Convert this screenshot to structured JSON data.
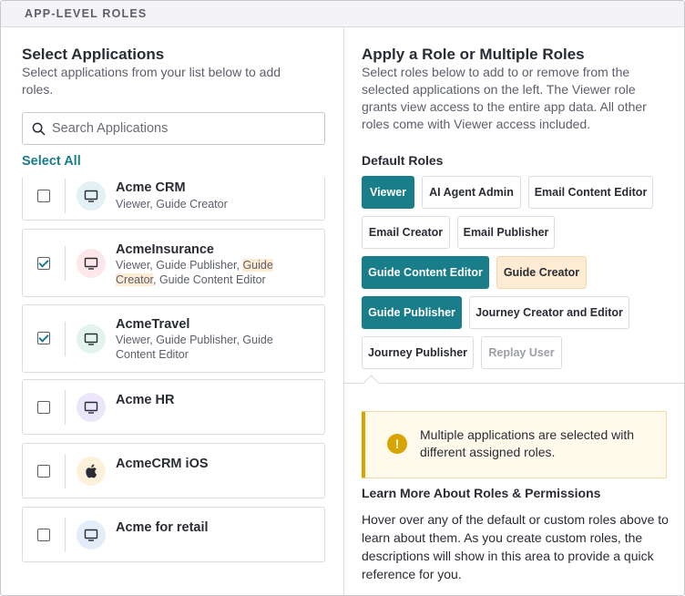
{
  "section": {
    "title": "APP-LEVEL ROLES"
  },
  "left": {
    "title": "Select Applications",
    "description": "Select applications from your list below to add roles.",
    "search_placeholder": "Search Applications",
    "select_all": "Select All",
    "apps": [
      {
        "name": "Acme CRM",
        "roles": "Viewer, Guide Creator",
        "checked": false,
        "icon": "desktop-icon",
        "icon_bg": "#e3f1f4"
      },
      {
        "name": "AcmeInsurance",
        "roles_parts": [
          "Viewer, Guide Publisher, ",
          "Guide Creator",
          ", Guide Content Editor"
        ],
        "checked": true,
        "icon": "desktop-icon",
        "icon_bg": "#fde7ea"
      },
      {
        "name": "AcmeTravel",
        "roles": "Viewer, Guide Publisher, Guide Content Editor",
        "checked": true,
        "icon": "desktop-icon",
        "icon_bg": "#e3f4ee"
      },
      {
        "name": "Acme HR",
        "roles": "",
        "checked": false,
        "icon": "desktop-icon",
        "icon_bg": "#ece6fa"
      },
      {
        "name": "AcmeCRM iOS",
        "roles": "",
        "checked": false,
        "icon": "apple-icon",
        "icon_bg": "#fdf1dc"
      },
      {
        "name": "Acme for retail",
        "roles": "",
        "checked": false,
        "icon": "desktop-icon",
        "icon_bg": "#e3edfa"
      }
    ]
  },
  "right": {
    "title": "Apply a Role or Multiple Roles",
    "description": "Select roles below to add to or remove from the selected applications on the left. The Viewer role grants view access to the entire app data. All other roles come with Viewer access included.",
    "default_roles_title": "Default Roles",
    "roles": [
      {
        "label": "Viewer",
        "state": "active"
      },
      {
        "label": "AI Agent Admin",
        "state": "default"
      },
      {
        "label": "Email Content Editor",
        "state": "default"
      },
      {
        "label": "Email Creator",
        "state": "default"
      },
      {
        "label": "Email Publisher",
        "state": "default"
      },
      {
        "label": "Guide Content Editor",
        "state": "active"
      },
      {
        "label": "Guide Creator",
        "state": "partial"
      },
      {
        "label": "Guide Publisher",
        "state": "active"
      },
      {
        "label": "Journey Creator and Editor",
        "state": "default"
      },
      {
        "label": "Journey Publisher",
        "state": "default"
      },
      {
        "label": "Replay User",
        "state": "disabled"
      }
    ],
    "warning": "Multiple applications are selected with different assigned roles.",
    "learn_title": "Learn More About Roles & Permissions",
    "learn_desc": "Hover over any of the default or custom roles above to learn about them. As you create custom roles, the descriptions will show in this area to provide a quick reference for you."
  },
  "colors": {
    "accent": "#1a7d8a",
    "partial": "#fdecd3",
    "warning": "#d9a400"
  }
}
